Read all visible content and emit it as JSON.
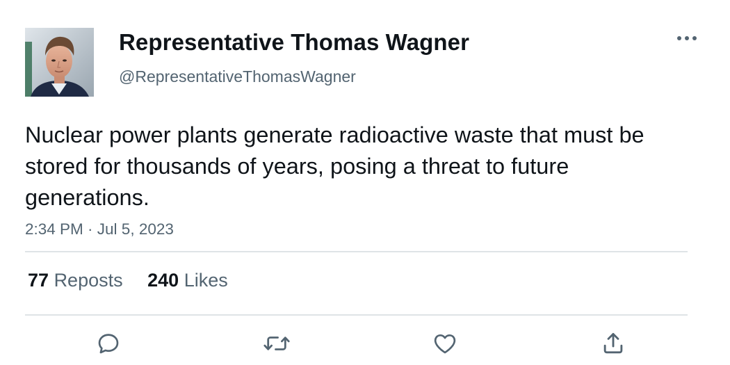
{
  "author": {
    "display_name": "Representative Thomas Wagner",
    "handle": "@RepresentativeThomasWagner",
    "avatar": "profile-photo"
  },
  "tweet": {
    "text": "Nuclear power plants generate radioactive waste that must be stored for thousands of years, posing a threat to future generations.",
    "timestamp": "2:34 PM · Jul 5, 2023"
  },
  "stats": {
    "reposts_count": "77",
    "reposts_label": "Reposts",
    "likes_count": "240",
    "likes_label": "Likes"
  },
  "icons": {
    "more": "more-horizontal-icon",
    "reply": "reply-icon",
    "repost": "repost-icon",
    "like": "heart-icon",
    "share": "share-icon"
  },
  "colors": {
    "text_primary": "#0f1419",
    "text_secondary": "#536471",
    "divider": "#dfe3e6",
    "icon": "#536471"
  }
}
